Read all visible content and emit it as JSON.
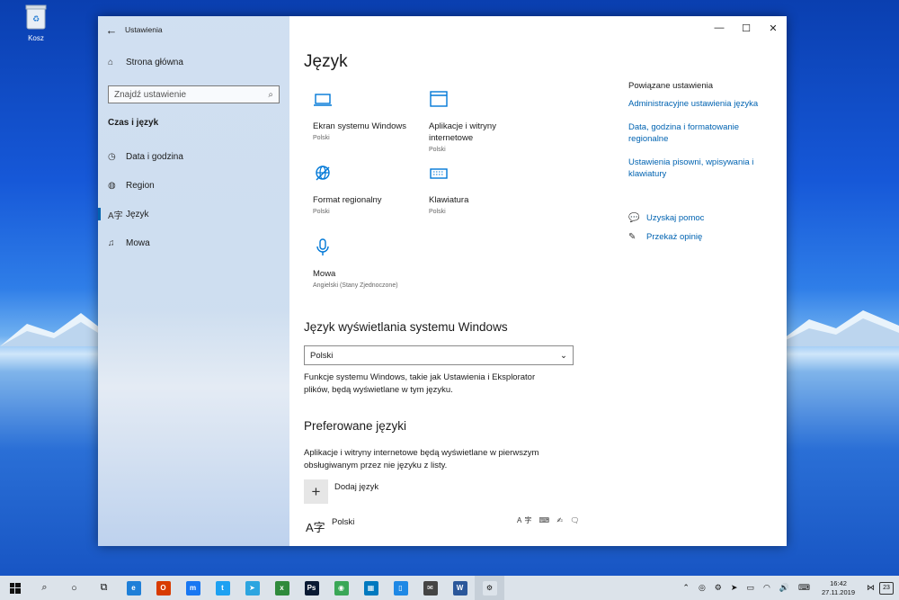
{
  "desktop": {
    "recycle_bin_label": "Kosz"
  },
  "window": {
    "title": "Ustawienia"
  },
  "nav": {
    "home_label": "Strona główna",
    "search_placeholder": "Znajdź ustawienie",
    "section_title": "Czas i język",
    "items": [
      {
        "label": "Data i godzina",
        "icon": "clock-icon"
      },
      {
        "label": "Region",
        "icon": "globe-icon"
      },
      {
        "label": "Język",
        "icon": "language-icon",
        "active": true
      },
      {
        "label": "Mowa",
        "icon": "microphone-icon"
      }
    ]
  },
  "main": {
    "title": "Język",
    "tiles": [
      {
        "title": "Ekran systemu Windows",
        "subtitle": "Polski",
        "icon": "laptop-icon"
      },
      {
        "title": "Aplikacje i witryny internetowe",
        "subtitle": "Polski",
        "icon": "window-icon"
      },
      {
        "title": "Format regionalny",
        "subtitle": "Polski",
        "icon": "regional-format-icon"
      },
      {
        "title": "Klawiatura",
        "subtitle": "Polski",
        "icon": "keyboard-icon"
      },
      {
        "title": "Mowa",
        "subtitle": "Angielski (Stany Zjednoczone)",
        "icon": "microphone-icon"
      }
    ],
    "display_language": {
      "heading": "Język wyświetlania systemu Windows",
      "selected": "Polski",
      "description": "Funkcje systemu Windows, takie jak Ustawienia i Eksplorator plików, będą wyświetlane w tym języku."
    },
    "preferred": {
      "heading": "Preferowane języki",
      "description": "Aplikacje i witryny internetowe będą wyświetlane w pierwszym obsługiwanym przez nie języku z listy.",
      "add_label": "Dodaj język",
      "languages": [
        {
          "name": "Polski"
        }
      ]
    }
  },
  "related": {
    "heading": "Powiązane ustawienia",
    "links": [
      "Administracyjne ustawienia języka",
      "Data, godzina i formatowanie regionalne",
      "Ustawienia pisowni, wpisywania i klawiatury"
    ],
    "help_label": "Uzyskaj pomoc",
    "feedback_label": "Przekaż opinię"
  },
  "taskbar": {
    "time": "16:42",
    "date": "27.11.2019",
    "notification_count": "23",
    "apps": [
      {
        "name": "edge",
        "color": "#1e7fd8",
        "glyph": "e"
      },
      {
        "name": "office",
        "color": "#d83b01",
        "glyph": "O"
      },
      {
        "name": "messenger",
        "color": "#1877f2",
        "glyph": "m"
      },
      {
        "name": "twitter",
        "color": "#1da1f2",
        "glyph": "t"
      },
      {
        "name": "telegram",
        "color": "#2ca5e0",
        "glyph": "➤"
      },
      {
        "name": "spreadsheet",
        "color": "#2f8a3c",
        "glyph": "x"
      },
      {
        "name": "photoshop",
        "color": "#0a1a33",
        "glyph": "Ps"
      },
      {
        "name": "chrome",
        "color": "#3aa757",
        "glyph": "◉"
      },
      {
        "name": "trello",
        "color": "#0079bf",
        "glyph": "▦"
      },
      {
        "name": "phone",
        "color": "#1e88e5",
        "glyph": "▯"
      },
      {
        "name": "mail",
        "color": "#444444",
        "glyph": "✉"
      },
      {
        "name": "word",
        "color": "#2b579a",
        "glyph": "W"
      },
      {
        "name": "settings",
        "color": "#dce3ea",
        "glyph": "⚙"
      }
    ]
  }
}
